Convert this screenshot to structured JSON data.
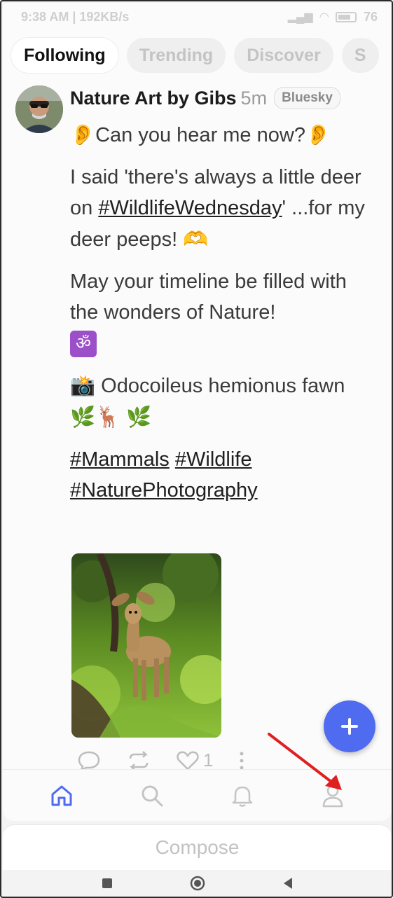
{
  "status_bar": {
    "time_speed": "9:38 AM | 192KB/s",
    "battery": "76",
    "battery_level": 0.76
  },
  "tabs": [
    {
      "label": "Following",
      "active": true
    },
    {
      "label": "Trending",
      "active": false
    },
    {
      "label": "Discover",
      "active": false
    },
    {
      "label": "S",
      "active": false
    }
  ],
  "post": {
    "author": "Nature Art by Gibs",
    "time": "5m",
    "badge": "Bluesky",
    "line1": "Can you hear me now?",
    "p2_a": "I said 'there's always a little deer on",
    "p2_tag": "#WildlifeWednesday",
    "p2_b": "' ...for my deer peeps!",
    "p3": "May your timeline be filled with the wonders of Nature!",
    "p4_a": "Odocoileus hemionus fawn",
    "tags": [
      "#Mammals",
      "#Wildlife",
      "#NaturePhotography"
    ],
    "like_count": "1"
  },
  "bottom_nav": {
    "items": [
      "home-icon",
      "search-icon",
      "bell-icon",
      "profile-icon"
    ]
  },
  "compose": {
    "label": "Compose"
  },
  "colors": {
    "accent": "#4f6bf0",
    "arrow": "#e02020"
  }
}
